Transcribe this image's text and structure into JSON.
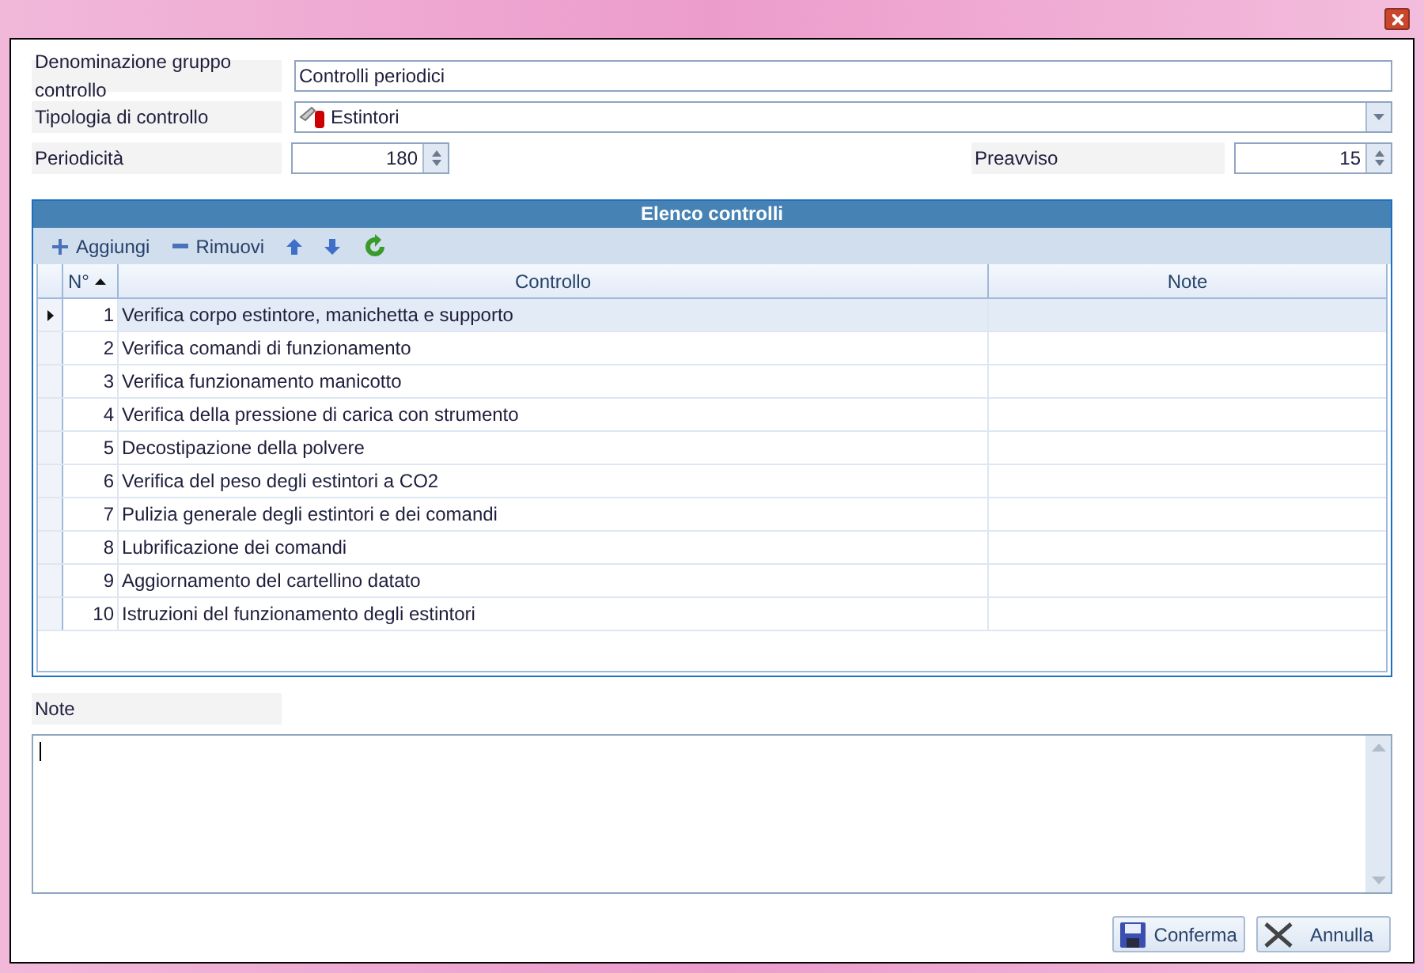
{
  "form": {
    "group_name": {
      "label": "Denominazione gruppo controllo",
      "value": "Controlli periodici"
    },
    "control_type": {
      "label": "Tipologia di controllo",
      "value": "Estintori"
    },
    "periodicity": {
      "label": "Periodicità",
      "value": "180"
    },
    "notice": {
      "label": "Preavviso",
      "value": "15"
    }
  },
  "grid": {
    "title": "Elenco controlli",
    "toolbar": [
      {
        "kind": "add",
        "label": "Aggiungi"
      },
      {
        "kind": "remove",
        "label": "Rimuovi"
      },
      {
        "kind": "up"
      },
      {
        "kind": "down"
      },
      {
        "kind": "refresh"
      }
    ],
    "columns": [
      "N°",
      "Controllo",
      "Note"
    ],
    "rows": [
      {
        "n": "1",
        "control": "Verifica corpo estintore, manichetta e supporto",
        "selected": true
      },
      {
        "n": "2",
        "control": "Verifica comandi di funzionamento",
        "selected": false
      },
      {
        "n": "3",
        "control": "Verifica funzionamento manicotto",
        "selected": false
      },
      {
        "n": "4",
        "control": "Verifica della pressione di carica con strumento",
        "selected": false
      },
      {
        "n": "5",
        "control": "Decostipazione della polvere",
        "selected": false
      },
      {
        "n": "6",
        "control": "Verifica del peso degli estintori a CO2",
        "selected": false
      },
      {
        "n": "7",
        "control": "Pulizia generale degli estintori e dei comandi",
        "selected": false
      },
      {
        "n": "8",
        "control": "Lubrificazione dei comandi",
        "selected": false
      },
      {
        "n": "9",
        "control": "Aggiornamento del cartellino datato",
        "selected": false
      },
      {
        "n": "10",
        "control": "Istruzioni del funzionamento degli estintori",
        "selected": false
      }
    ]
  },
  "notes": {
    "label": "Note"
  },
  "buttons": [
    {
      "kind": "confirm",
      "label": "Conferma"
    },
    {
      "kind": "cancel",
      "label": "Annulla"
    }
  ]
}
